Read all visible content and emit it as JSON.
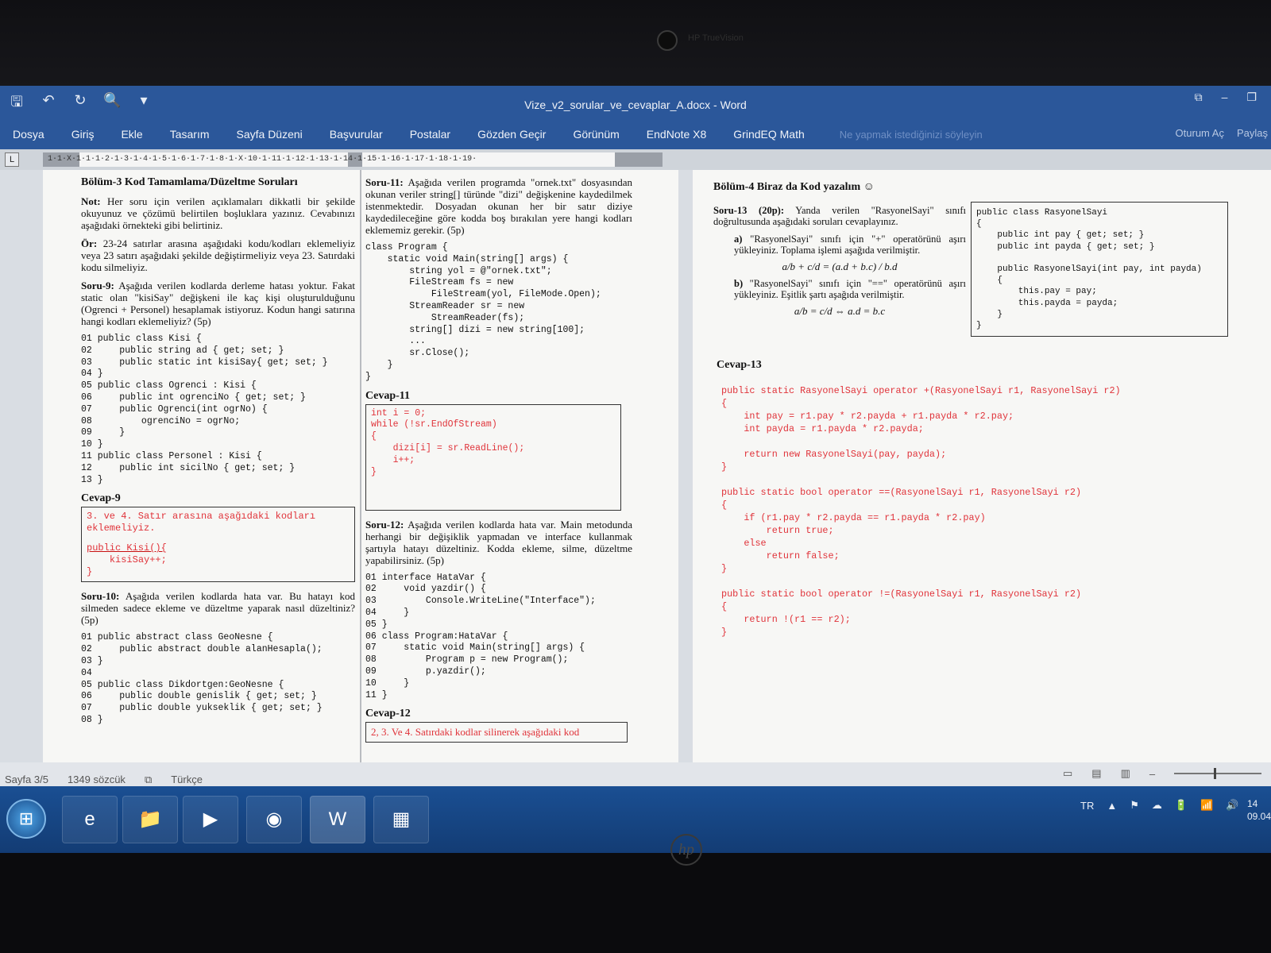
{
  "window": {
    "title": "Vize_v2_sorular_ve_cevaplar_A.docx - Word",
    "controls": [
      "⧉",
      "–",
      "❐"
    ]
  },
  "camera": {
    "label": "HP TrueVision"
  },
  "qat": {
    "save": "🖫",
    "undo": "↶",
    "redo": "↻",
    "preview": "🔍",
    "more": "▾"
  },
  "ribbon": {
    "tabs": [
      "Dosya",
      "Giriş",
      "Ekle",
      "Tasarım",
      "Sayfa Düzeni",
      "Başvurular",
      "Postalar",
      "Gözden Geçir",
      "Görünüm",
      "EndNote X8",
      "GrindEQ Math"
    ],
    "tell_me": "Ne yapmak istediğinizi söyleyin",
    "sign_in": "Oturum Aç",
    "share": "Paylaş"
  },
  "ruler": {
    "corner": "L",
    "ticks": "1·1·X·1·1·1·2·1·3·1·4·1·5·1·6·1·7·1·8·1·X·10·1·11·1·12·1·13·1·14·1·15·1·16·1·17·1·18·1·19·"
  },
  "colA": {
    "heading": "Bölüm-3 Kod Tamamlama/Düzeltme Soruları",
    "note_label": "Not:",
    "note": "Her soru için verilen açıklamaları dikkatli bir şekilde okuyunuz ve çözümü belirtilen boşluklara yazınız. Cevabınızı aşağıdaki örnekteki gibi belirtiniz.",
    "ex_label": "Ör:",
    "ex": "23-24 satırlar arasına aşağıdaki kodu/kodları eklemeliyiz veya 23 satırı aşağıdaki şekilde değiştirmeliyiz veya 23. Satırdaki kodu silmeliyiz.",
    "q9_label": "Soru-9:",
    "q9": "Aşağıda verilen kodlarda derleme hatası yoktur. Fakat static olan \"kisiSay\" değişkeni ile kaç kişi oluşturulduğunu (Ogrenci + Personel) hesaplamak istiyoruz. Kodun hangi satırına hangi kodları eklemeliyiz? (5p)",
    "q9_code": "01 public class Kisi {\n02     public string ad { get; set; }\n03     public static int kisiSay{ get; set; }\n04 }\n05 public class Ogrenci : Kisi {\n06     public int ogrenciNo { get; set; }\n07     public Ogrenci(int ogrNo) {\n08         ogrenciNo = ogrNo;\n09     }\n10 }\n11 public class Personel : Kisi {\n12     public int sicilNo { get; set; }\n13 }",
    "a9_title": "Cevap-9",
    "a9_line1": "3. ve 4. Satır arasına aşağıdaki kodları eklemeliyiz.",
    "a9_line2": "public Kisi(){",
    "a9_line3": "    kisiSay++;",
    "a9_line4": "}",
    "q10_label": "Soru-10:",
    "q10": "Aşağıda verilen kodlarda hata var. Bu hatayı kod silmeden sadece ekleme ve düzeltme yaparak nasıl düzeltiniz? (5p)",
    "q10_code": "01 public abstract class GeoNesne {\n02     public abstract double alanHesapla();\n03 }\n04\n05 public class Dikdortgen:GeoNesne {\n06     public double genislik { get; set; }\n07     public double yukseklik { get; set; }\n08 }"
  },
  "colB": {
    "q11_label": "Soru-11:",
    "q11": "Aşağıda verilen programda \"ornek.txt\" dosyasından okunan veriler string[] türünde \"dizi\" değişkenine kaydedilmek istenmektedir. Dosyadan okunan her bir satır diziye kaydedileceğine göre kodda boş bırakılan yere hangi kodları eklememiz gerekir. (5p)",
    "q11_code": "class Program {\n    static void Main(string[] args) {\n        string yol = @\"ornek.txt\";\n        FileStream fs = new\n            FileStream(yol, FileMode.Open);\n        StreamReader sr = new\n            StreamReader(fs);\n        string[] dizi = new string[100];\n        ...\n        sr.Close();\n    }\n}",
    "a11_title": "Cevap-11",
    "a11_code": "int i = 0;\nwhile (!sr.EndOfStream)\n{\n    dizi[i] = sr.ReadLine();\n    i++;\n}",
    "q12_label": "Soru-12:",
    "q12": "Aşağıda verilen kodlarda hata var. Main metodunda herhangi bir değişiklik yapmadan ve interface kullanmak şartıyla hatayı düzeltiniz. Kodda ekleme, silme, düzeltme yapabilirsiniz. (5p)",
    "q12_code": "01 interface HataVar {\n02     void yazdir() {\n03         Console.WriteLine(\"Interface\");\n04     }\n05 }\n06 class Program:HataVar {\n07     static void Main(string[] args) {\n08         Program p = new Program();\n09         p.yazdir();\n10     }\n11 }",
    "a12_title": "Cevap-12",
    "a12_text": "2, 3. Ve 4. Satırdaki kodlar silinerek aşağıdaki kod"
  },
  "right": {
    "heading": "Bölüm-4 Biraz da Kod yazalım ☺",
    "q13_label": "Soru-13 (20p):",
    "q13": "Yanda verilen \"RasyonelSayi\" sınıfı doğrultusunda aşağıdaki soruları cevaplayınız.",
    "a_label": "a)",
    "a_text": "\"RasyonelSayi\" sınıfı için \"+\" operatörünü aşırı yükleyiniz. Toplama işlemi aşağıda verilmiştir.",
    "a_formula": "a/b + c/d = (a.d + b.c) / b.d",
    "b_label": "b)",
    "b_text": "\"RasyonelSayi\" sınıfı için \"==\" operatörünü aşırı yükleyiniz. Eşitlik şartı aşağıda verilmiştir.",
    "b_formula": "a/b = c/d ⇔ a.d = b.c",
    "class_code": "public class RasyonelSayi\n{\n    public int pay { get; set; }\n    public int payda { get; set; }\n\n    public RasyonelSayi(int pay, int payda)\n    {\n        this.pay = pay;\n        this.payda = payda;\n    }\n}",
    "a13_title": "Cevap-13",
    "a13_code": "public static RasyonelSayi operator +(RasyonelSayi r1, RasyonelSayi r2)\n{\n    int pay = r1.pay * r2.payda + r1.payda * r2.pay;\n    int payda = r1.payda * r2.payda;\n\n    return new RasyonelSayi(pay, payda);\n}\n\npublic static bool operator ==(RasyonelSayi r1, RasyonelSayi r2)\n{\n    if (r1.pay * r2.payda == r1.payda * r2.pay)\n        return true;\n    else\n        return false;\n}\n\npublic static bool operator !=(RasyonelSayi r1, RasyonelSayi r2)\n{\n    return !(r1 == r2);\n}"
  },
  "status": {
    "page": "Sayfa 3/5",
    "words": "1349 sözcük",
    "proof_icon": "⧉",
    "language": "Türkçe",
    "zoom_minus": "–",
    "zoom_plus": "+"
  },
  "taskbar": {
    "start": "⊞",
    "apps": [
      "e",
      "📁",
      "▶",
      "◉",
      "W",
      "▦"
    ],
    "lang": "TR",
    "tray_icons": [
      "▲",
      "⚑",
      "☁",
      "🔋",
      "📶",
      "🔊"
    ],
    "time": "14",
    "date": "09.04"
  },
  "hp_logo": "hp"
}
